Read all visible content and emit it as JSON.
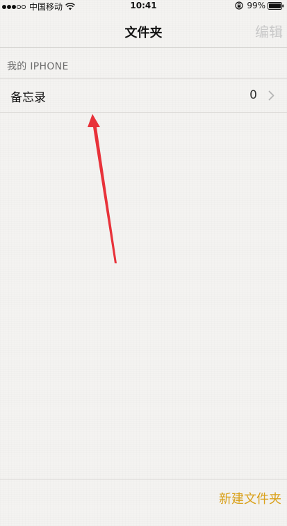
{
  "status_bar": {
    "carrier": "中国移动",
    "time": "10:41",
    "battery_percent": "99%",
    "signal_bars_filled": 3,
    "signal_bars_total": 5
  },
  "nav": {
    "title": "文件夹",
    "edit_label": "编辑"
  },
  "section": {
    "header": "我的 IPHONE",
    "folders": [
      {
        "name": "备忘录",
        "count": "0"
      }
    ]
  },
  "toolbar": {
    "new_folder_label": "新建文件夹"
  },
  "colors": {
    "accent": "#d9a019",
    "disabled": "#c9c9c9",
    "annotation_arrow": "#e8323a"
  },
  "icons": [
    "signal-dots-icon",
    "wifi-icon",
    "lock-rotation-icon",
    "battery-icon",
    "chevron-right-icon",
    "annotation-arrow"
  ]
}
